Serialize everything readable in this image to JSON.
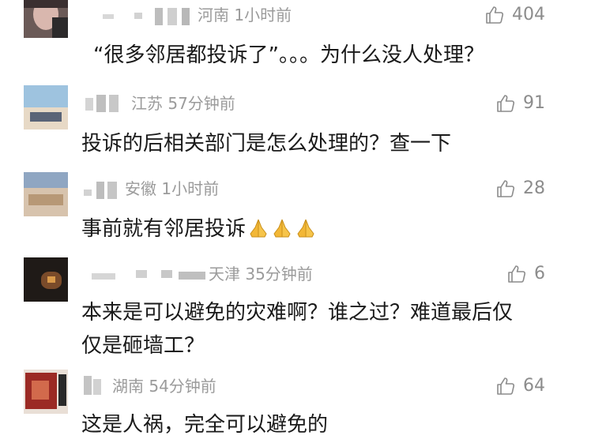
{
  "comments": [
    {
      "location": "河南",
      "time": "1小时前",
      "likes": "404",
      "text": "“很多邻居都投诉了”。。。为什么没人处理？",
      "text2": ""
    },
    {
      "location": "江苏",
      "time": "57分钟前",
      "likes": "91",
      "text": "投诉的后相关部门是怎么处理的？查一下",
      "text2": ""
    },
    {
      "location": "安徽",
      "time": "1小时前",
      "likes": "28",
      "text": "事前就有邻居投诉",
      "text2": "",
      "emoji": "🙏🙏🙏"
    },
    {
      "location": "天津",
      "time": "35分钟前",
      "likes": "6",
      "text": "本来是可以避免的灾难啊？谁之过？难道最后仅",
      "text2": "仅是砸墙工？"
    },
    {
      "location": "湖南",
      "time": "54分钟前",
      "likes": "64",
      "text": "这是人祸，完全可以避免的",
      "text2": ""
    }
  ],
  "icons": {
    "like": "thumbs-up-icon",
    "pray": "folded-hands-icon"
  },
  "colors": {
    "meta": "#9b9b9b",
    "text": "#1a1a1a",
    "blur": "#c9c9c9"
  }
}
